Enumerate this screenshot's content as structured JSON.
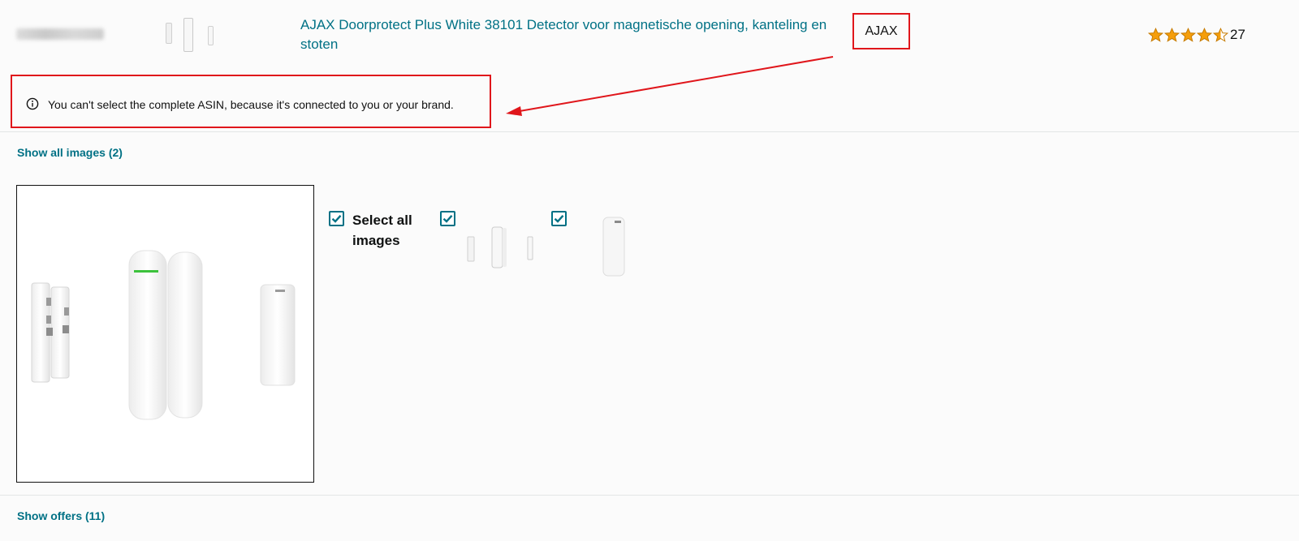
{
  "product": {
    "title": "AJAX Doorprotect Plus White 38101 Detector voor magnetische opening, kanteling en stoten",
    "brand": "AJAX",
    "rating": 4.5,
    "rating_count": "27",
    "star_color": "#f59e0b"
  },
  "notice": {
    "text": "You can't select the complete ASIN, because it's connected to you or your brand."
  },
  "images": {
    "show_all_label": "Show all images (2)",
    "select_all_label": "Select all images",
    "select_all_checked": true,
    "items": [
      {
        "checked": true
      },
      {
        "checked": true
      }
    ]
  },
  "offers": {
    "show_offers_label": "Show offers (11)"
  },
  "colors": {
    "link": "#007185",
    "annotation_red": "#e0161b",
    "checkbox": "#007185"
  }
}
